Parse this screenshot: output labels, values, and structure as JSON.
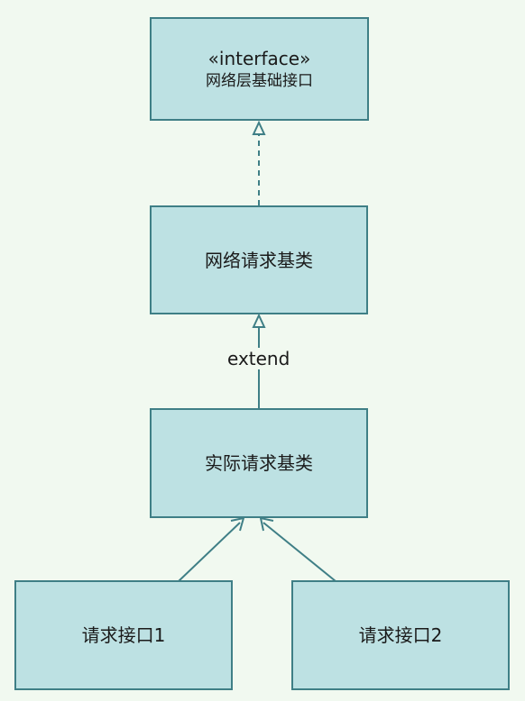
{
  "colors": {
    "background": "#f1f9f0",
    "box_fill": "#bde1e3",
    "box_border": "#3f7f86",
    "edge": "#3f7f86"
  },
  "nodes": {
    "interface": {
      "stereotype": "«interface»",
      "name": "网络层基础接口"
    },
    "base_request": {
      "name": "网络请求基类"
    },
    "actual_request": {
      "name": "实际请求基类"
    },
    "api1": {
      "name": "请求接口1"
    },
    "api2": {
      "name": "请求接口2"
    }
  },
  "edges": {
    "realization": {
      "type": "realization",
      "from": "base_request",
      "to": "interface"
    },
    "extend": {
      "type": "generalization",
      "from": "actual_request",
      "to": "base_request",
      "label": "extend"
    },
    "api1_to_actual": {
      "type": "association",
      "from": "api1",
      "to": "actual_request"
    },
    "api2_to_actual": {
      "type": "association",
      "from": "api2",
      "to": "actual_request"
    }
  }
}
